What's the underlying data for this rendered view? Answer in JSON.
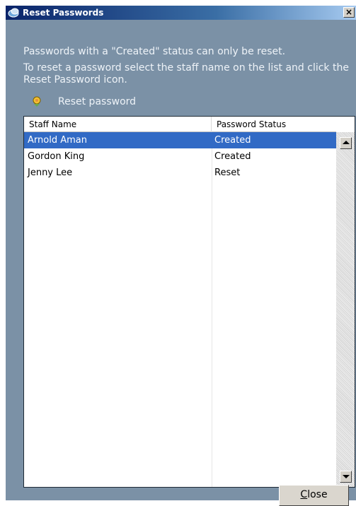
{
  "window": {
    "title": "Reset Passwords",
    "close_glyph": "×",
    "title_icon": "reset-passwords-app-icon"
  },
  "messages": {
    "line1": "Passwords with a \"Created\" status can only be reset.",
    "line2": "To reset a password select the staff name on the list and click the Reset Password icon."
  },
  "action": {
    "icon": "reset-password-icon",
    "label": "Reset password"
  },
  "table": {
    "columns": [
      "Staff Name",
      "Password Status"
    ],
    "rows": [
      {
        "name": "Arnold Aman",
        "status": "Created",
        "selected": true
      },
      {
        "name": "Gordon King",
        "status": "Created",
        "selected": false
      },
      {
        "name": "Jenny Lee",
        "status": "Reset",
        "selected": false
      }
    ]
  },
  "footer": {
    "close_mnemonic": "C",
    "close_rest": "lose"
  },
  "colors": {
    "window_bg": "#7b91a6",
    "title_bar": "#0a246a",
    "selection": "#316ac5"
  }
}
